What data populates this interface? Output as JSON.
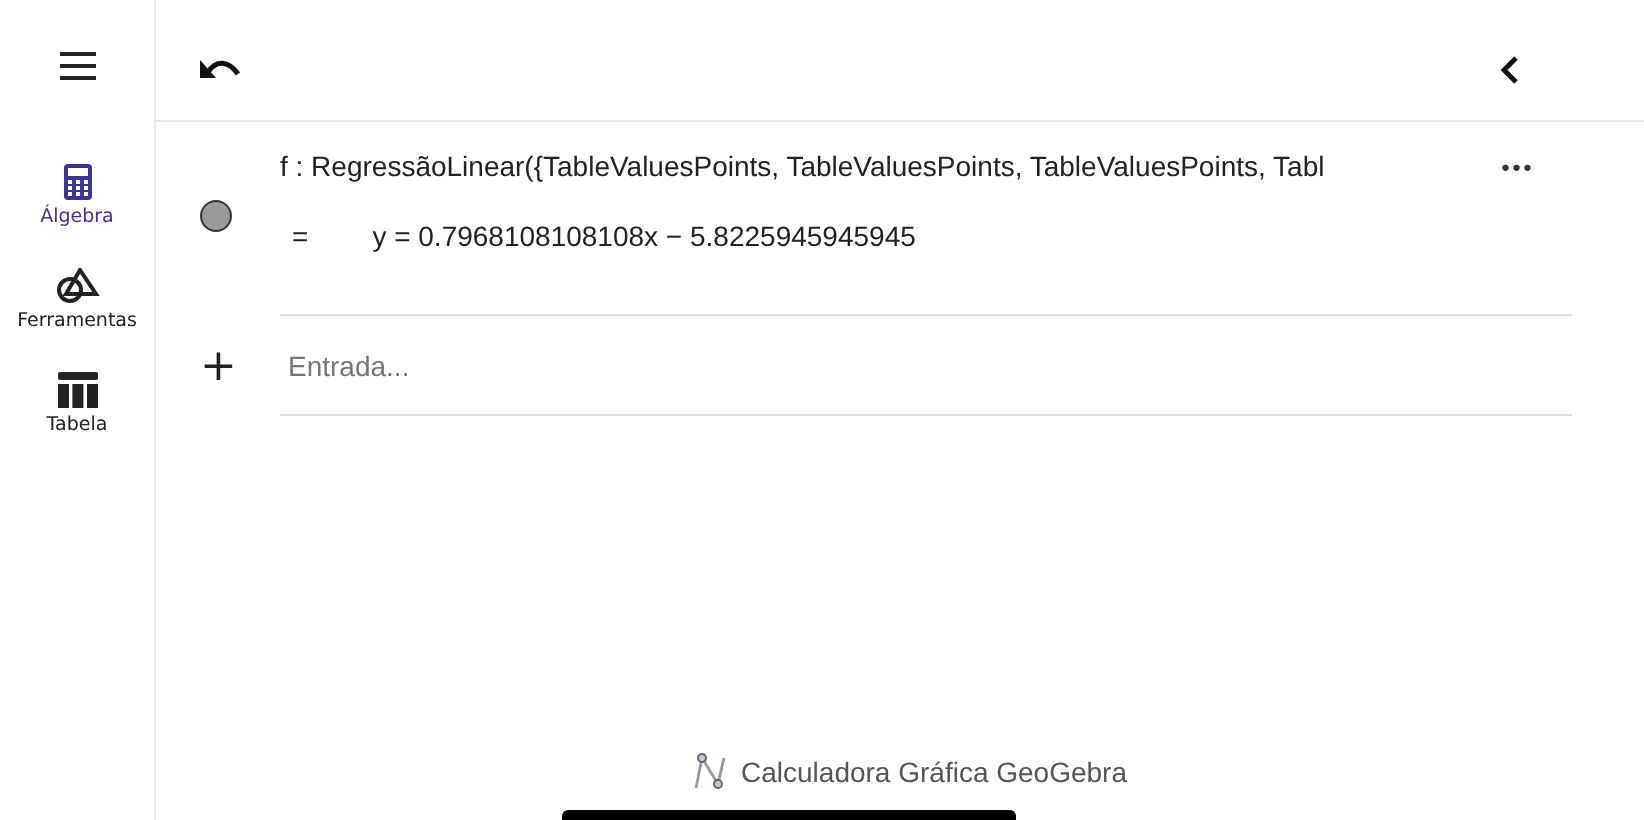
{
  "sidebar": {
    "items": [
      {
        "kind": "calculator",
        "label": "Álgebra",
        "selected": true
      },
      {
        "kind": "tools",
        "label": "Ferramentas",
        "selected": false
      },
      {
        "kind": "table",
        "label": "Tabela",
        "selected": false
      }
    ]
  },
  "algebra": {
    "entries": [
      {
        "definition": "f : RegressãoLinear({TableValuesPoints, TableValuesPoints, TableValuesPoints, Tabl",
        "result_sign": "=",
        "result": "y = 0.7968108108108x − 5.8225945945945",
        "visible": false,
        "more": "•••"
      }
    ],
    "input": {
      "sign": "+",
      "placeholder": "Entrada..."
    }
  },
  "footer": {
    "title": "Calculadora Gráfica GeoGebra"
  }
}
